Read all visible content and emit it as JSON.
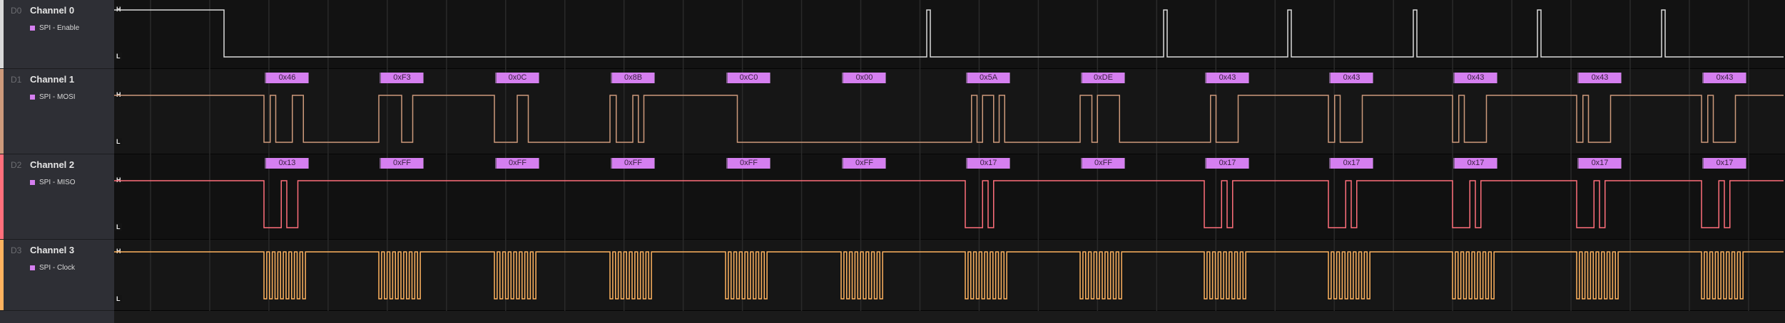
{
  "channels": [
    {
      "id": "D0",
      "name": "Channel 0",
      "analyzer": "SPI - Enable",
      "color": "#d9d9d9"
    },
    {
      "id": "D1",
      "name": "Channel 1",
      "analyzer": "SPI - MOSI",
      "color": "#cd9a7b"
    },
    {
      "id": "D2",
      "name": "Channel 2",
      "analyzer": "SPI - MISO",
      "color": "#ff6f7b"
    },
    {
      "id": "D3",
      "name": "Channel 3",
      "analyzer": "SPI - Clock",
      "color": "#ffb35f"
    }
  ],
  "markers": {
    "high": "H",
    "low": "L"
  },
  "analyzer_color": "#d57ff0",
  "mosi_bytes": [
    "0x46",
    "0xF3",
    "0x0C",
    "0x8B",
    "0xC0",
    "0x00",
    "0x5A",
    "0xDE",
    "0x43",
    "0x43",
    "0x43",
    "0x43",
    "0x43"
  ],
  "miso_bytes": [
    "0x13",
    "0xFF",
    "0xFF",
    "0xFF",
    "0xFF",
    "0xFF",
    "0x17",
    "0xFF",
    "0x17",
    "0x17",
    "0x17",
    "0x17",
    "0x17"
  ]
}
